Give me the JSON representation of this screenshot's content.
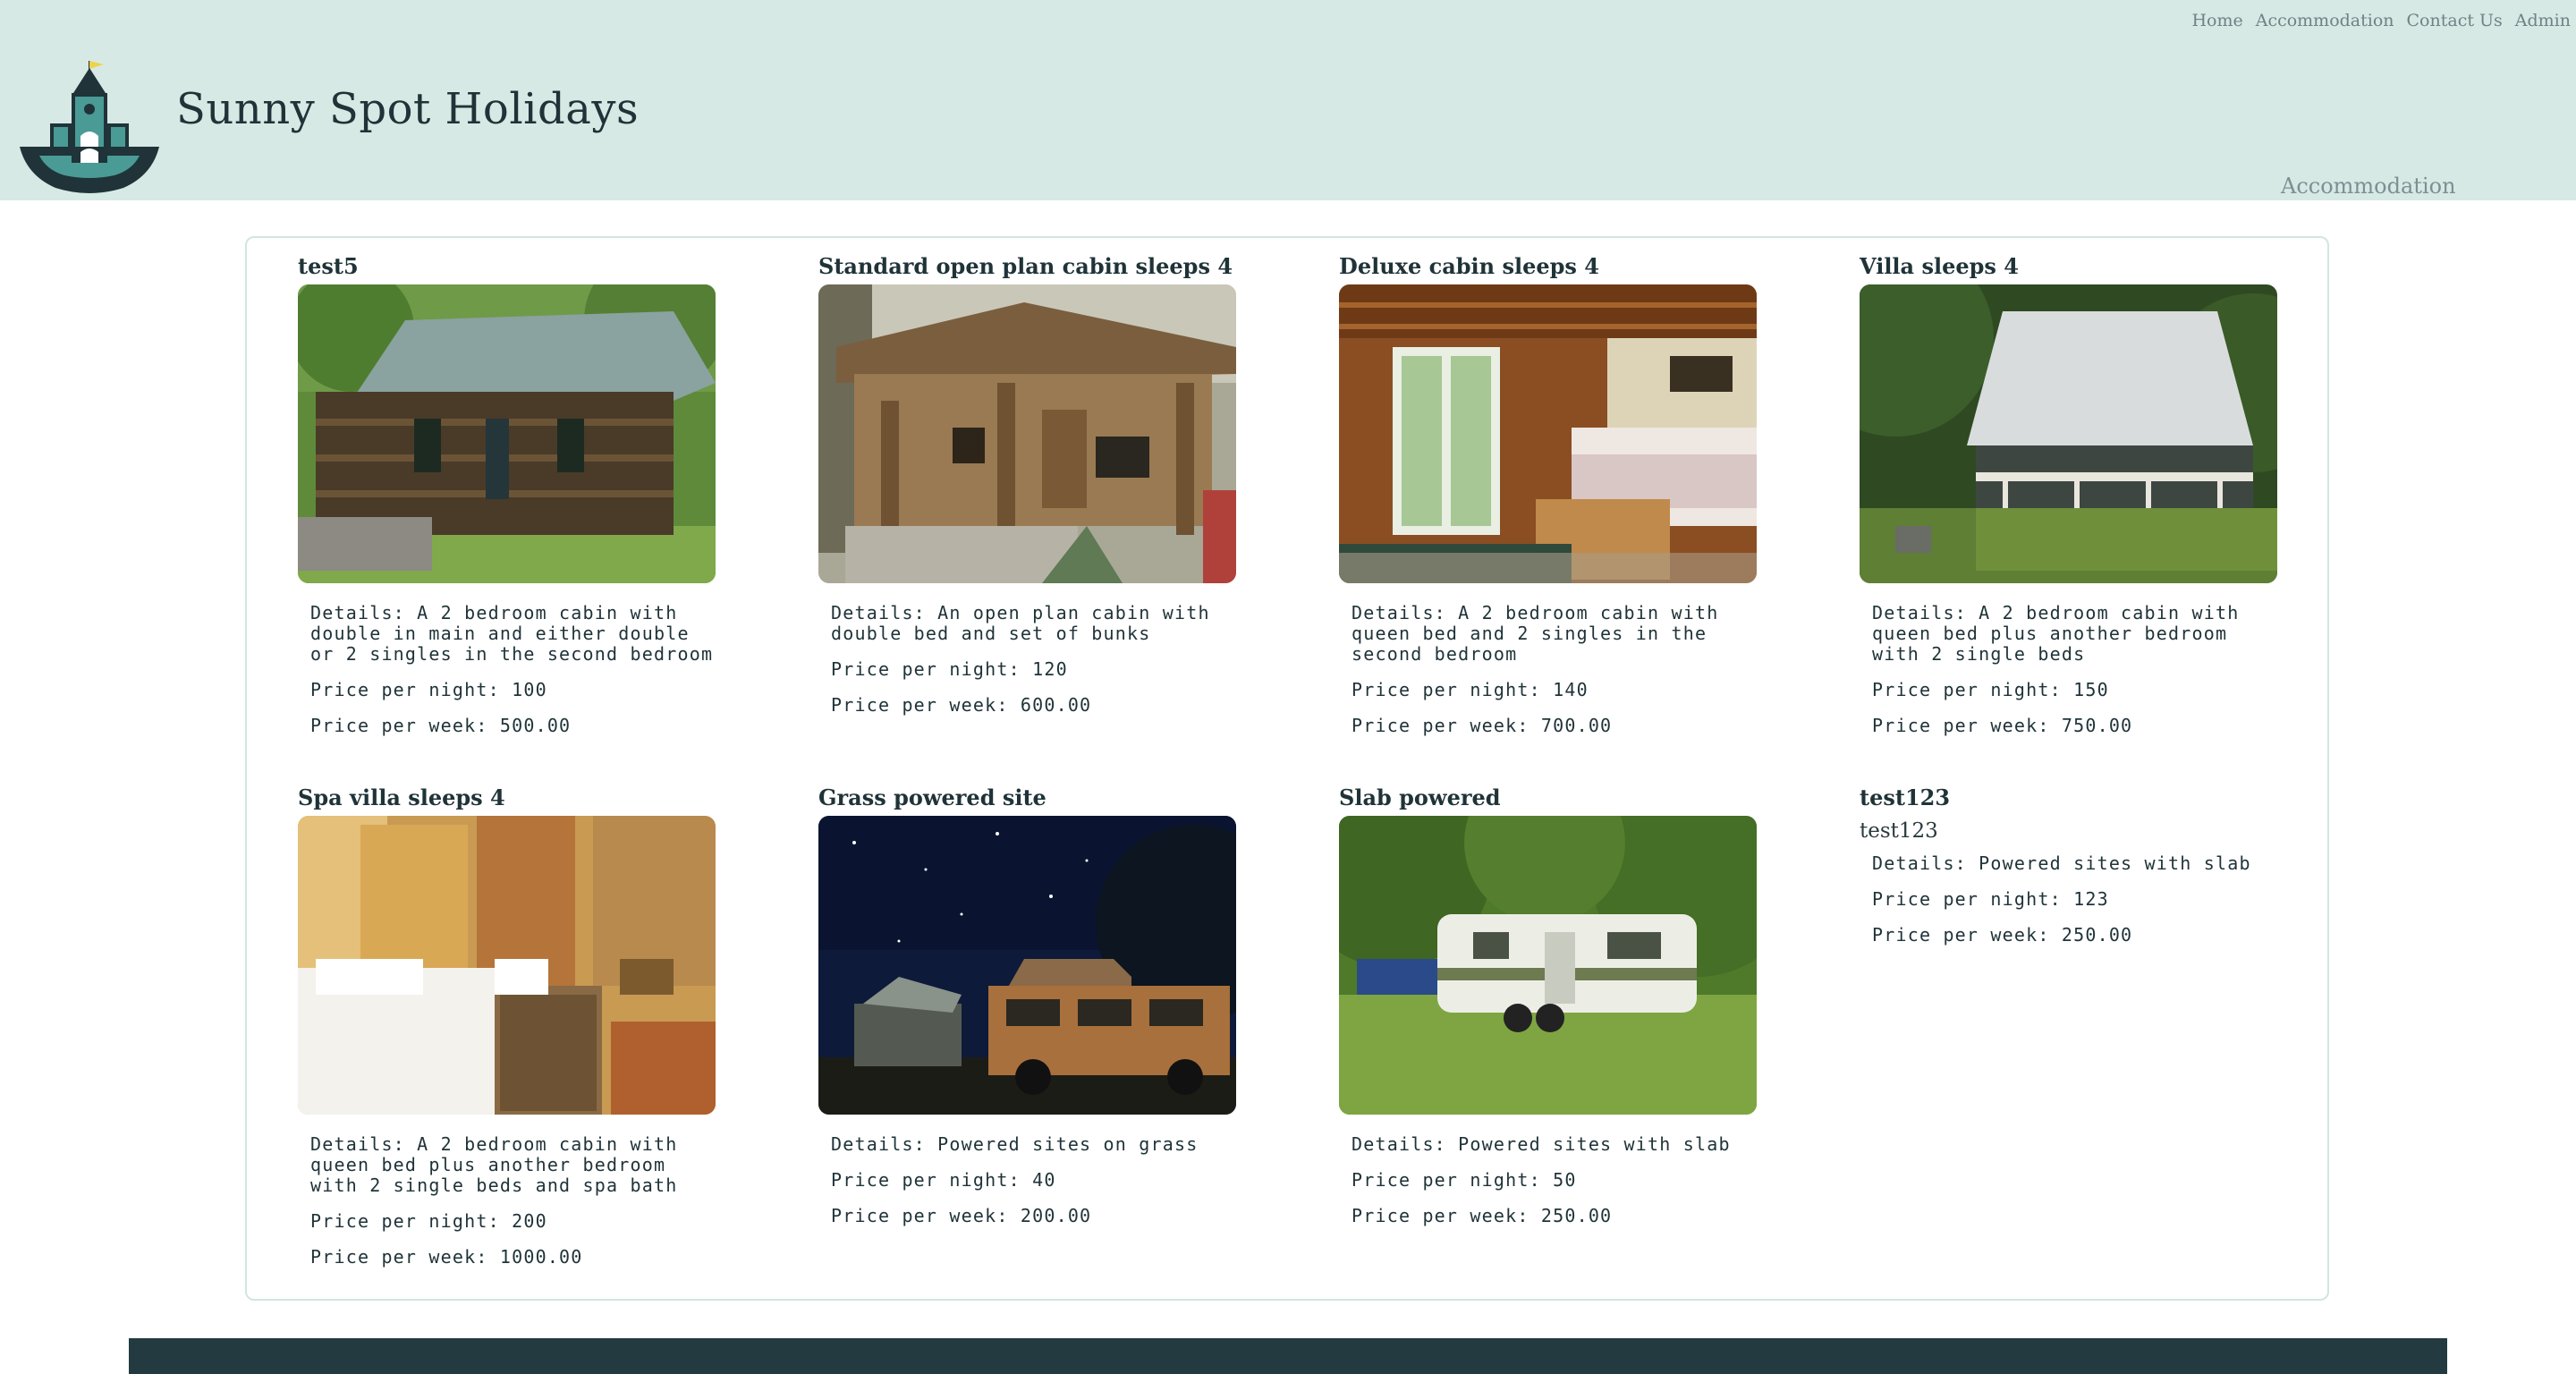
{
  "site": {
    "title": "Sunny Spot Holidays"
  },
  "nav": {
    "home": "Home",
    "accommodation": "Accommodation",
    "contact": "Contact Us",
    "admin": "Admin"
  },
  "subnav": {
    "label": "Accommodation"
  },
  "colors": {
    "header_bg": "#d6e9e4",
    "accent": "#223a40",
    "panel_border": "#d3e5e0"
  },
  "listings": [
    {
      "title": "test5",
      "image": "log-cabin-photo",
      "details": "Details: A 2 bedroom cabin with double in main and either double or 2 singles in the second bedroom",
      "night": "Price per night: 100",
      "week": "Price per week: 500.00"
    },
    {
      "title": "Standard open plan cabin sleeps 4",
      "image": "wooden-cabin-photo",
      "details": "Details: An open plan cabin with double bed and set of bunks",
      "night": "Price per night: 120",
      "week": "Price per week: 600.00"
    },
    {
      "title": "Deluxe cabin sleeps 4",
      "image": "cabin-bedroom-photo",
      "details": "Details: A 2 bedroom cabin with queen bed and 2 singles in the second bedroom",
      "night": "Price per night: 140",
      "week": "Price per week: 700.00"
    },
    {
      "title": "Villa sleeps 4",
      "image": "villa-photo",
      "details": "Details: A 2 bedroom cabin with queen bed plus another bedroom with 2 single beds",
      "night": "Price per night: 150",
      "week": "Price per week: 750.00"
    },
    {
      "title": "Spa villa sleeps 4",
      "image": "hotel-room-photo",
      "details": "Details: A 2 bedroom cabin with queen bed plus another bedroom with 2 single beds and spa bath",
      "night": "Price per night: 200",
      "week": "Price per week: 1000.00"
    },
    {
      "title": "Grass powered site",
      "image": "night-campervan-photo",
      "details": "Details: Powered sites on grass",
      "night": "Price per night: 40",
      "week": "Price per week: 200.00"
    },
    {
      "title": "Slab powered",
      "image": "caravan-photo",
      "details": "Details: Powered sites with slab",
      "night": "Price per night: 50",
      "week": "Price per week: 250.00"
    },
    {
      "title": "test123",
      "image_alt": "test123",
      "details": "Details: Powered sites with slab",
      "night": "Price per night: 123",
      "week": "Price per week: 250.00"
    }
  ]
}
